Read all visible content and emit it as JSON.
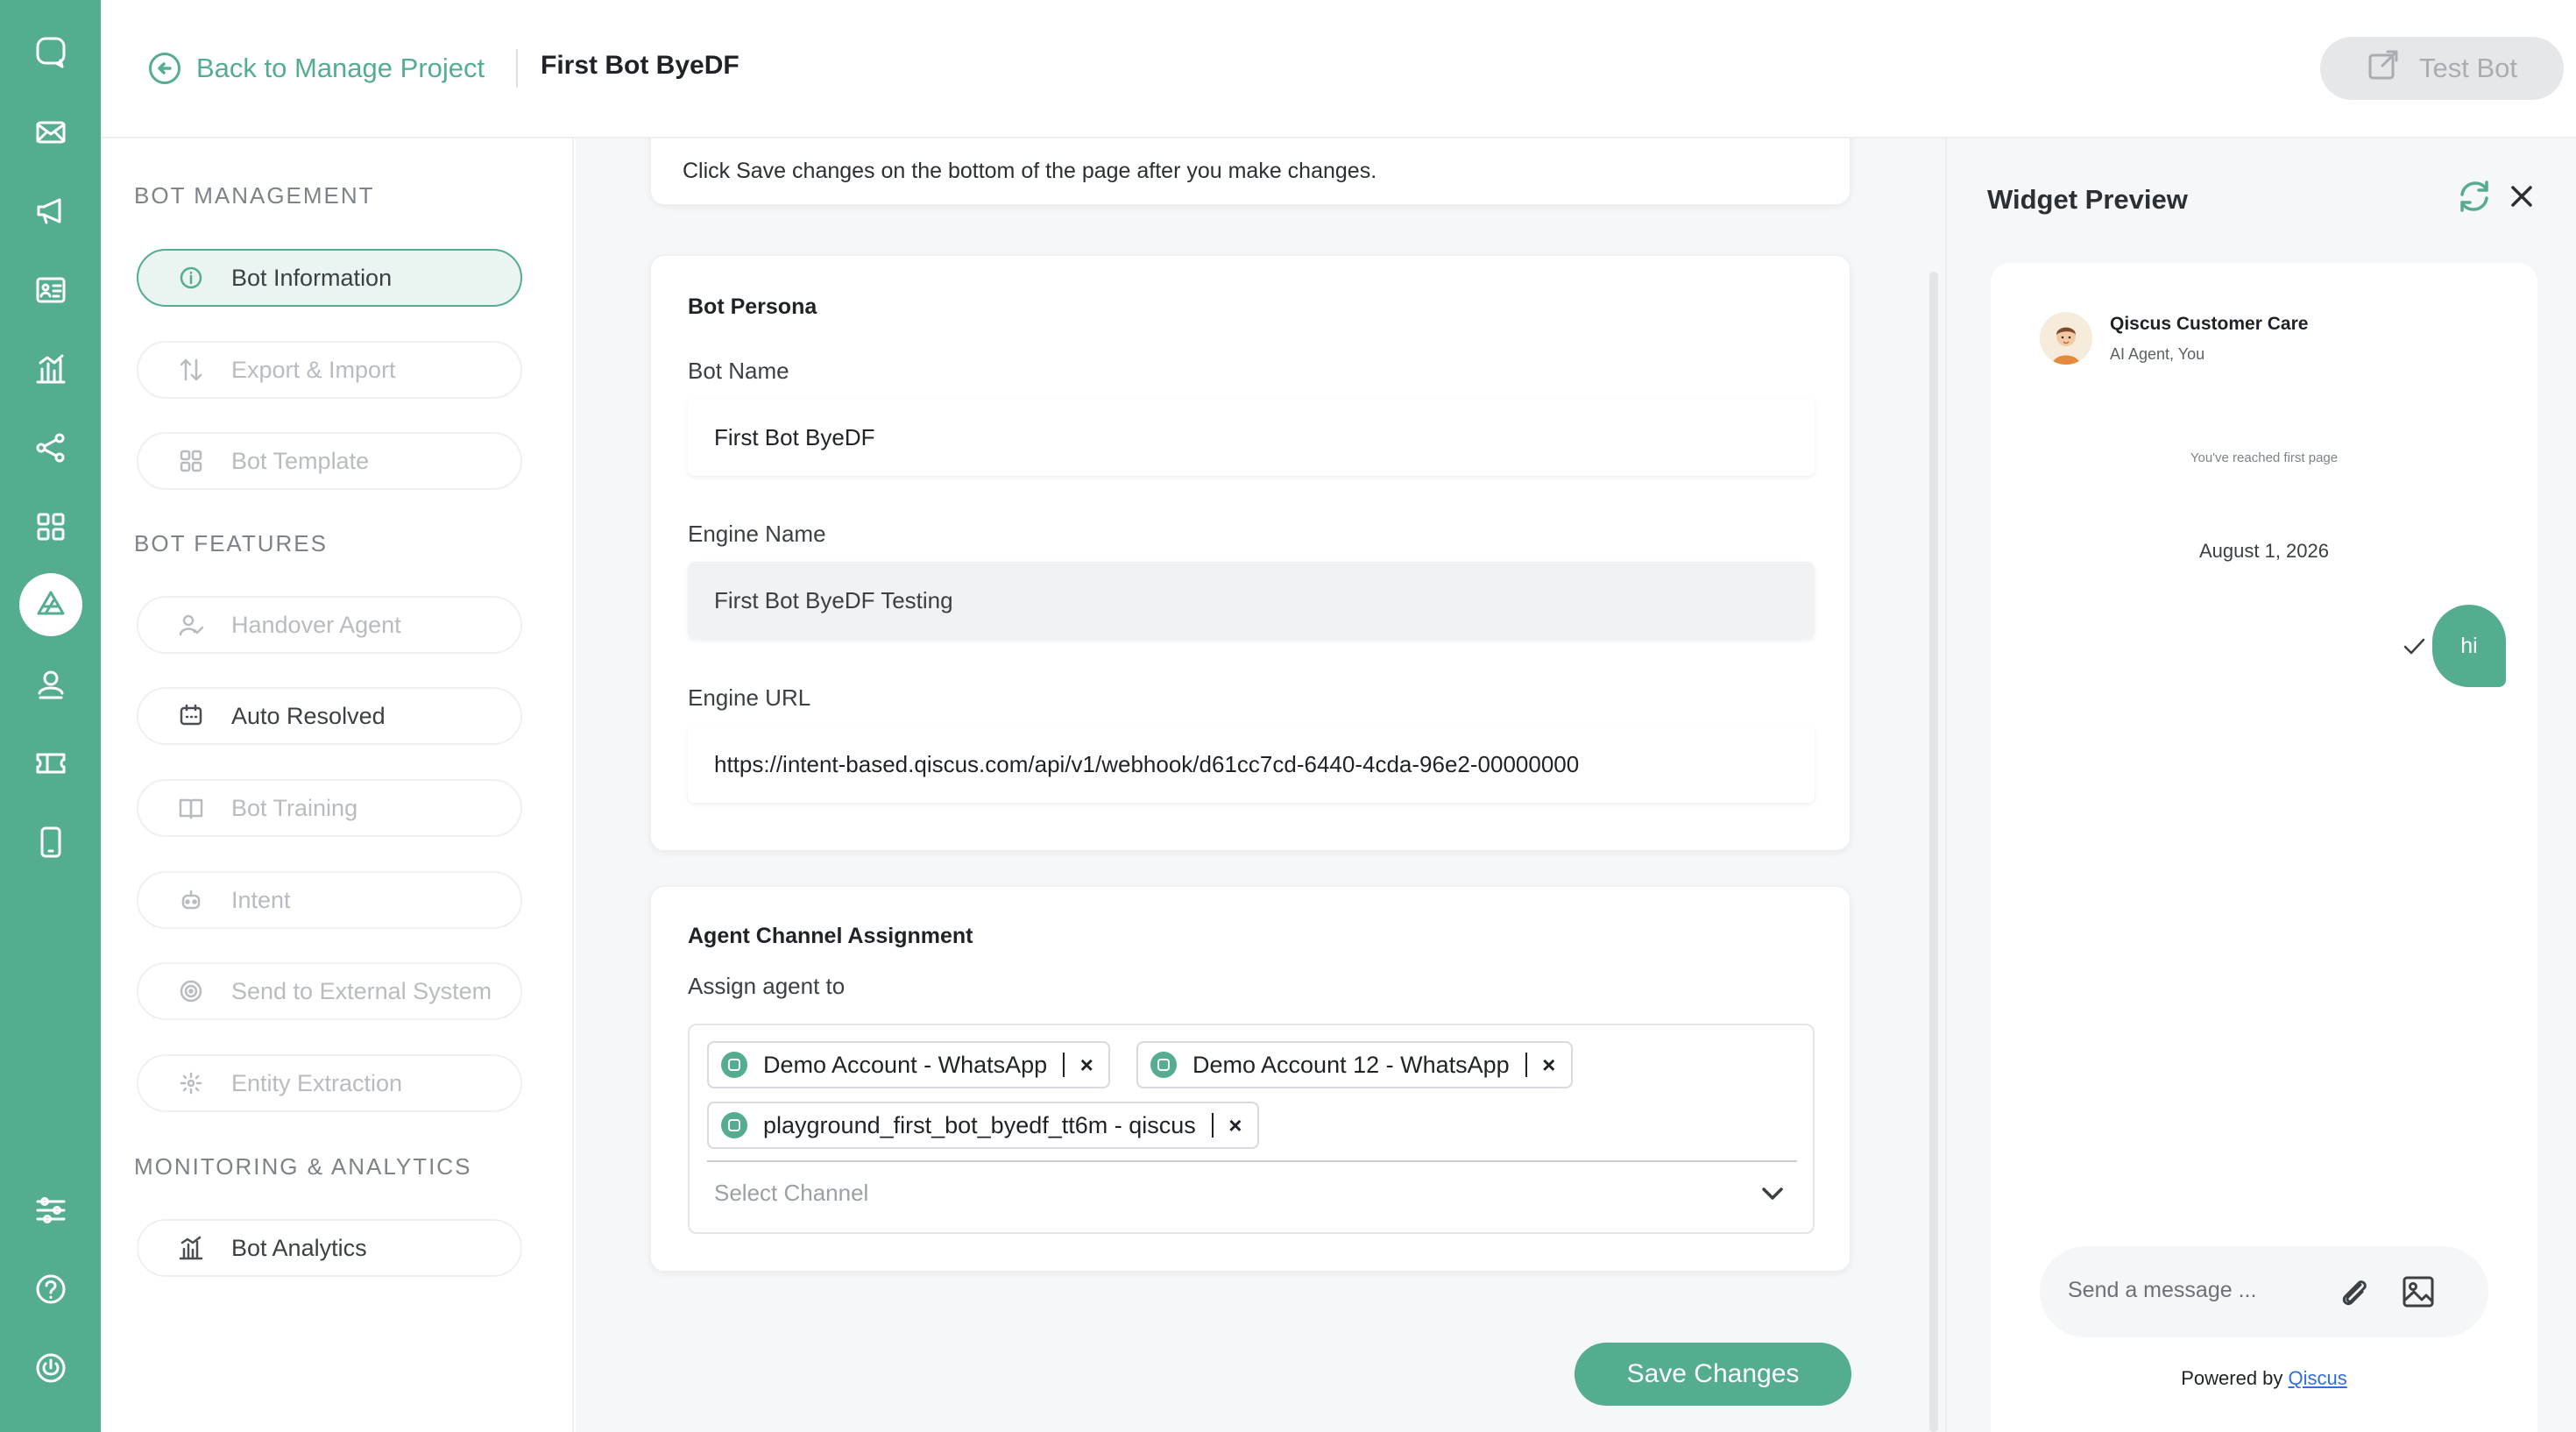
{
  "header": {
    "back_label": "Back to Manage Project",
    "project_title": "First Bot ByeDF",
    "test_bot_label": "Test Bot"
  },
  "rail": {
    "icons": [
      "chat-logo-icon",
      "mail-icon",
      "megaphone-icon",
      "contact-card-icon",
      "chart-icon",
      "share-nodes-icon",
      "apps-grid-icon",
      "bot-logo-icon",
      "agent-icon",
      "ticket-icon",
      "mobile-icon",
      "settings-sliders-icon",
      "help-icon",
      "power-icon"
    ],
    "active": "bot-logo-icon"
  },
  "sidebar": {
    "sections": [
      {
        "title": "BOT MANAGEMENT",
        "items": [
          {
            "label": "Bot Information",
            "icon": "info-icon",
            "state": "active"
          },
          {
            "label": "Export & Import",
            "icon": "arrows-up-down-icon",
            "state": "disabled"
          },
          {
            "label": "Bot Template",
            "icon": "template-grid-icon",
            "state": "disabled"
          }
        ]
      },
      {
        "title": "BOT FEATURES",
        "items": [
          {
            "label": "Handover Agent",
            "icon": "user-check-icon",
            "state": "disabled"
          },
          {
            "label": "Auto Resolved",
            "icon": "calendar-chat-icon",
            "state": "enabled"
          },
          {
            "label": "Bot Training",
            "icon": "book-icon",
            "state": "disabled"
          },
          {
            "label": "Intent",
            "icon": "robot-icon",
            "state": "disabled"
          },
          {
            "label": "Send to External System",
            "icon": "target-icon",
            "state": "disabled"
          },
          {
            "label": "Entity Extraction",
            "icon": "scatter-icon",
            "state": "disabled"
          }
        ]
      },
      {
        "title": "MONITORING & ANALYTICS",
        "items": [
          {
            "label": "Bot Analytics",
            "icon": "analytics-icon",
            "state": "enabled"
          }
        ]
      }
    ]
  },
  "main": {
    "note": "Click Save changes on the bottom of the page after you make changes.",
    "persona": {
      "title": "Bot Persona",
      "bot_name_label": "Bot Name",
      "bot_name_value": "First Bot ByeDF",
      "engine_name_label": "Engine Name",
      "engine_name_value": "First Bot ByeDF Testing",
      "engine_url_label": "Engine URL",
      "engine_url_value": "https://intent-based.qiscus.com/api/v1/webhook/d61cc7cd-6440-4cda-96e2-00000000"
    },
    "assignment": {
      "title": "Agent Channel Assignment",
      "assign_label": "Assign agent to",
      "chips": [
        "Demo Account - WhatsApp",
        "Demo Account 12 - WhatsApp",
        "playground_first_bot_byedf_tt6m - qiscus"
      ],
      "chip_remove": "×",
      "select_placeholder": "Select Channel"
    },
    "save_label": "Save Changes"
  },
  "preview": {
    "title": "Widget Preview",
    "agent_name": "Qiscus Customer Care",
    "agent_sub": "AI Agent, You",
    "first_page_text": "You've reached first page",
    "date_label": "August 1, 2026",
    "message": "hi",
    "composer_placeholder": "Send a message ...",
    "powered_by": "Powered by",
    "powered_link": "Qiscus"
  },
  "colors": {
    "accent": "#55ad8f",
    "link": "#2f6fe0"
  }
}
